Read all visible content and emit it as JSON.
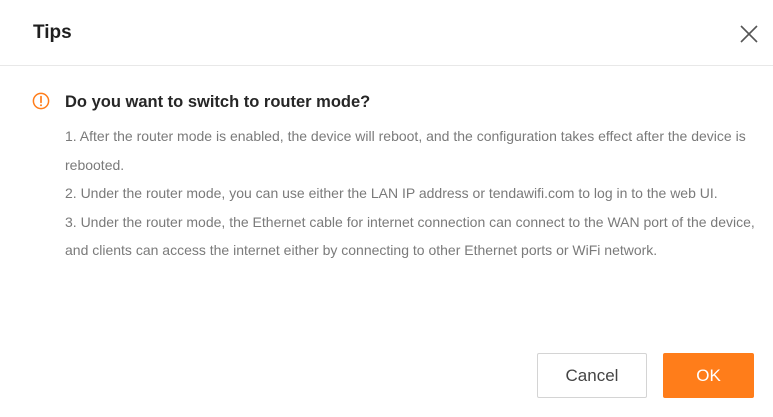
{
  "dialog": {
    "title": "Tips",
    "close_icon": "close-icon",
    "warning_icon": "warning-circle-icon",
    "question": "Do you want to switch to router mode?",
    "notes": [
      "1. After the router mode is enabled, the device will reboot, and the configuration takes effect after the device is rebooted.",
      "2. Under the router mode, you can use either the LAN IP address or tendawifi.com to log in to the web UI.",
      "3. Under the router mode, the Ethernet cable for internet connection can connect to the WAN port of the device, and clients can access the internet either by connecting to other Ethernet ports or WiFi network."
    ],
    "cancel_label": "Cancel",
    "ok_label": "OK"
  },
  "colors": {
    "accent": "#ff7d1a",
    "warning": "#ff7d1a",
    "title_text": "#1f1f1f",
    "body_text": "#7a7a7a"
  }
}
